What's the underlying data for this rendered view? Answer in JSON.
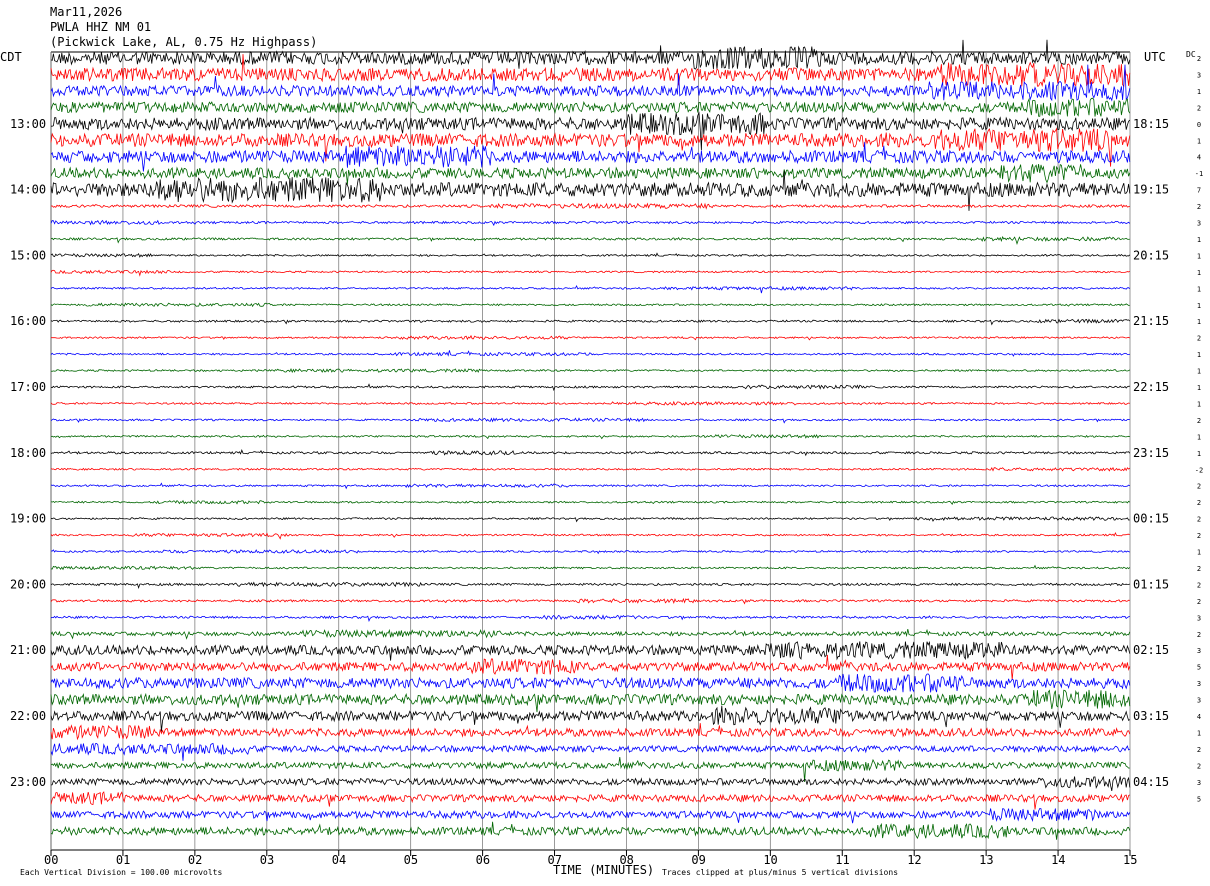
{
  "header": {
    "date": "Mar11,2026",
    "station": "PWLA HHZ NM 01",
    "location": "(Pickwick Lake, AL, 0.75 Hz Highpass)"
  },
  "axis": {
    "left_tz": "CDT",
    "right_tz": "UTC",
    "dc_label": "DC",
    "xlabel": "TIME (MINUTES)",
    "note_left": "Each Vertical Division =  100.00 microvolts",
    "note_right": "Traces clipped at plus/minus 5 vertical divisions"
  },
  "colors": {
    "trace_cycle": [
      "#000000",
      "#ff0000",
      "#0000ff",
      "#006600"
    ],
    "grid": "#808080"
  },
  "chart_data": {
    "type": "line",
    "x_ticks": [
      "00",
      "01",
      "02",
      "03",
      "04",
      "05",
      "06",
      "07",
      "08",
      "09",
      "10",
      "11",
      "12",
      "13",
      "14",
      "15"
    ],
    "xlim": [
      0,
      15
    ],
    "left_hour_labels": [
      "13:00",
      "14:00",
      "15:00",
      "16:00",
      "17:00",
      "18:00",
      "19:00",
      "20:00",
      "21:00",
      "22:00",
      "23:00"
    ],
    "right_hour_labels": [
      "18:15",
      "19:15",
      "20:15",
      "21:15",
      "22:15",
      "23:15",
      "00:15",
      "01:15",
      "02:15",
      "03:15",
      "04:15"
    ],
    "trace_count": 48,
    "first_hour_label_row": 4,
    "dc_offsets": [
      "2",
      "3",
      "1",
      "2",
      "0",
      "1",
      "4",
      "-1",
      "7",
      "2",
      "3",
      "1",
      "1",
      "1",
      "1",
      "1",
      "1",
      "2",
      "1",
      "1",
      "1",
      "1",
      "2",
      "1",
      "1",
      "-2",
      "2",
      "2",
      "2",
      "2",
      "1",
      "2",
      "2",
      "2",
      "3",
      "2",
      "3",
      "5",
      "3",
      "3",
      "4",
      "1",
      "2",
      "2",
      "3",
      "5"
    ],
    "noise_levels": [
      3,
      3,
      2.4,
      2.4,
      2.8,
      3,
      2.8,
      2.4,
      3.2,
      0.6,
      0.5,
      0.5,
      0.4,
      0.4,
      0.4,
      0.4,
      0.45,
      0.4,
      0.4,
      0.4,
      0.45,
      0.4,
      0.4,
      0.4,
      0.5,
      0.4,
      0.4,
      0.4,
      0.4,
      0.4,
      0.4,
      0.4,
      0.5,
      0.5,
      0.5,
      0.9,
      2.2,
      2,
      2.4,
      2.4,
      2.2,
      1.8,
      1.4,
      1.4,
      1.5,
      1.6,
      1.6,
      1.8
    ]
  }
}
